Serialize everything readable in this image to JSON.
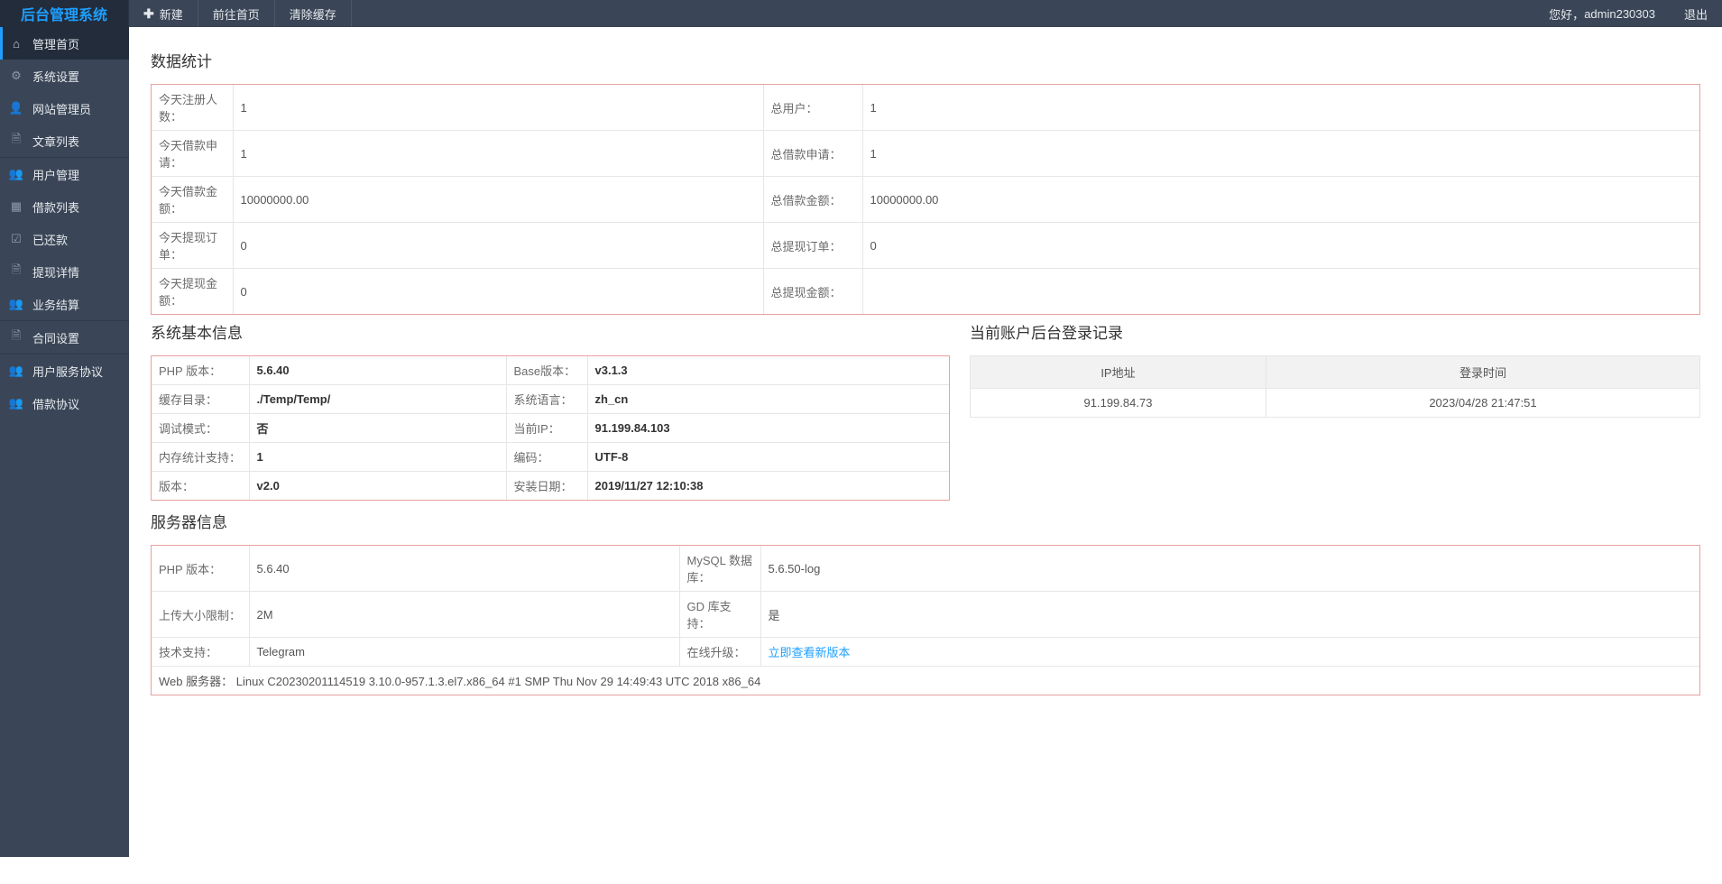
{
  "brand": "后台管理系统",
  "topbar": {
    "new_label": "新建",
    "home_label": "前往首页",
    "clear_cache_label": "清除缓存",
    "greeting_prefix": "您好，",
    "username": "admin230303",
    "logout_label": "退出"
  },
  "sidebar": {
    "groups": [
      {
        "items": [
          {
            "key": "home",
            "label": "管理首页",
            "icon": "home-icon",
            "glyph": "⌂",
            "active": true
          },
          {
            "key": "settings",
            "label": "系统设置",
            "icon": "gear-icon",
            "glyph": "⚙"
          },
          {
            "key": "admins",
            "label": "网站管理员",
            "icon": "user-icon",
            "glyph": "👤"
          },
          {
            "key": "articles",
            "label": "文章列表",
            "icon": "document-icon",
            "glyph": "🗎"
          }
        ]
      },
      {
        "items": [
          {
            "key": "users",
            "label": "用户管理",
            "icon": "users-icon",
            "glyph": "👥"
          },
          {
            "key": "loans",
            "label": "借款列表",
            "icon": "grid-icon",
            "glyph": "▦"
          },
          {
            "key": "repaid",
            "label": "已还款",
            "icon": "calendar-icon",
            "glyph": "☑"
          },
          {
            "key": "withdraw",
            "label": "提现详情",
            "icon": "detail-icon",
            "glyph": "🗎"
          },
          {
            "key": "settle",
            "label": "业务结算",
            "icon": "settle-icon",
            "glyph": "👥"
          }
        ]
      },
      {
        "items": [
          {
            "key": "contract",
            "label": "合同设置",
            "icon": "contract-icon",
            "glyph": "🗎"
          }
        ]
      },
      {
        "items": [
          {
            "key": "tos",
            "label": "用户服务协议",
            "icon": "agreement-icon",
            "glyph": "👥"
          },
          {
            "key": "loan-agree",
            "label": "借款协议",
            "icon": "agreement-icon",
            "glyph": "👥"
          }
        ]
      }
    ]
  },
  "sections": {
    "stats_title": "数据统计",
    "system_title": "系统基本信息",
    "login_log_title": "当前账户后台登录记录",
    "server_title": "服务器信息"
  },
  "stats": {
    "rows": [
      {
        "l1": "今天注册人数：",
        "v1": "1",
        "l2": "总用户：",
        "v2": "1"
      },
      {
        "l1": "今天借款申请：",
        "v1": "1",
        "l2": "总借款申请：",
        "v2": "1"
      },
      {
        "l1": "今天借款金额：",
        "v1": "10000000.00",
        "l2": "总借款金额：",
        "v2": "10000000.00"
      },
      {
        "l1": "今天提现订单：",
        "v1": "0",
        "l2": "总提现订单：",
        "v2": "0"
      },
      {
        "l1": "今天提现金额：",
        "v1": "0",
        "l2": "总提现金额：",
        "v2": ""
      }
    ]
  },
  "system_info": {
    "rows": [
      {
        "l1": "PHP 版本：",
        "v1": "5.6.40",
        "l2": "Base版本：",
        "v2": "v3.1.3"
      },
      {
        "l1": "缓存目录：",
        "v1": "./Temp/Temp/",
        "l2": "系统语言：",
        "v2": "zh_cn"
      },
      {
        "l1": "调试模式：",
        "v1": "否",
        "l2": "当前IP：",
        "v2": "91.199.84.103"
      },
      {
        "l1": "内存统计支持：",
        "v1": "1",
        "l2": "编码：",
        "v2": "UTF-8"
      },
      {
        "l1": "版本：",
        "v1": "v2.0",
        "l2": "安装日期：",
        "v2": "2019/11/27 12:10:38"
      }
    ]
  },
  "login_log": {
    "headers": {
      "ip": "IP地址",
      "time": "登录时间"
    },
    "rows": [
      {
        "ip": "91.199.84.73",
        "time": "2023/04/28 21:47:51"
      }
    ]
  },
  "server_info": {
    "rows": [
      {
        "l1": "PHP 版本：",
        "v1": "5.6.40",
        "l2": "MySQL 数据库：",
        "v2": "5.6.50-log"
      },
      {
        "l1": "上传大小限制：",
        "v1": "2M",
        "l2": "GD 库支持：",
        "v2": "是"
      },
      {
        "l1": "技术支持：",
        "v1": "Telegram",
        "l2": "在线升级：",
        "v2": "立即查看新版本",
        "v2link": true
      }
    ],
    "footer_label": "Web 服务器：",
    "footer_value": "Linux C20230201114519 3.10.0-957.1.3.el7.x86_64 #1 SMP Thu Nov 29 14:49:43 UTC 2018 x86_64"
  }
}
